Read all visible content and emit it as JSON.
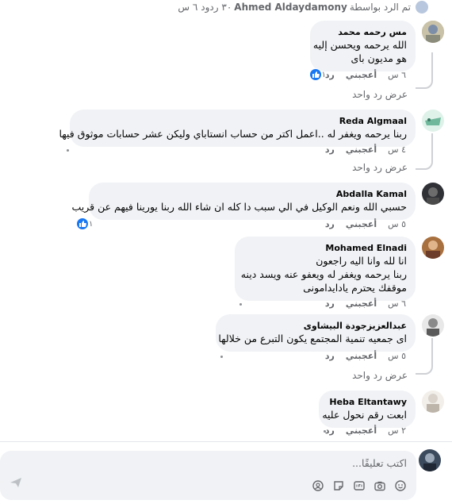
{
  "top_replies": {
    "by_prefix": "تم الرد بواسطة",
    "author": "Ahmed Aldaydamony",
    "count": "٣٠ ردود",
    "time": "٦ س"
  },
  "comments": [
    {
      "name": "مس رحمه محمد",
      "lines": [
        "الله يرحمه ويحسن إليه",
        "هو مديون باى"
      ],
      "time": "٦ س",
      "like": "أعجبني",
      "reply": "رد",
      "reactions": "١",
      "view_replies": "عرض رد واحد",
      "avatar_color": "#b7a984"
    },
    {
      "name": "Reda Algmaal",
      "lines": [
        "ربنا يرحمه ويغفر له ..اعمل اكتر من حساب انستاباي وليكن عشر حسابات موثوق فيها"
      ],
      "time": "٤ س",
      "like": "أعجبني",
      "reply": "رد",
      "view_replies": "عرض رد واحد",
      "avatar_color": "#6fb89c"
    },
    {
      "name": "Abdalla Kamal",
      "lines": [
        "حسبي الله ونعم الوكيل في الي سبب دا كله ان شاء الله ربنا يورينا فيهم عن قريب"
      ],
      "time": "٥ س",
      "like": "أعجبني",
      "reply": "رد",
      "reactions": "١",
      "avatar_color": "#2f3136"
    },
    {
      "name": "Mohamed Elnadi",
      "lines": [
        "انا لله وانا اليه راجعون",
        "ربنا يرحمه ويغفر له ويعفو عنه ويسد دينه",
        "موقفك يحترم يادايدامونى"
      ],
      "time": "٦ س",
      "like": "أعجبني",
      "reply": "رد",
      "avatar_color": "#7a4b3a"
    },
    {
      "name": "عبدالعزيزجودة البيشاوى",
      "lines": [
        "اى جمعيه تنمية المجتمع يكون التبرع من خلالها"
      ],
      "time": "٥ س",
      "like": "أعجبني",
      "reply": "رد",
      "view_replies": "عرض رد واحد",
      "avatar_color": "#9a9a9a"
    },
    {
      "name": "Heba Eltantawy",
      "lines": [
        "ابعت رقم نحول عليه"
      ],
      "time": "٢ س",
      "like": "أعجبني",
      "reply": "رد",
      "avatar_color": "#d9d3cc"
    }
  ],
  "composer": {
    "placeholder": "اكتب تعليقًا...",
    "tools": [
      "emoji-icon",
      "camera-icon",
      "gif-icon",
      "sticker-icon",
      "avatar-sticker-icon"
    ],
    "send_icon": "send-icon"
  },
  "colors": {
    "bubble": "#f0f2f5",
    "meta": "#65676b",
    "like_blue": "#1877f2"
  }
}
